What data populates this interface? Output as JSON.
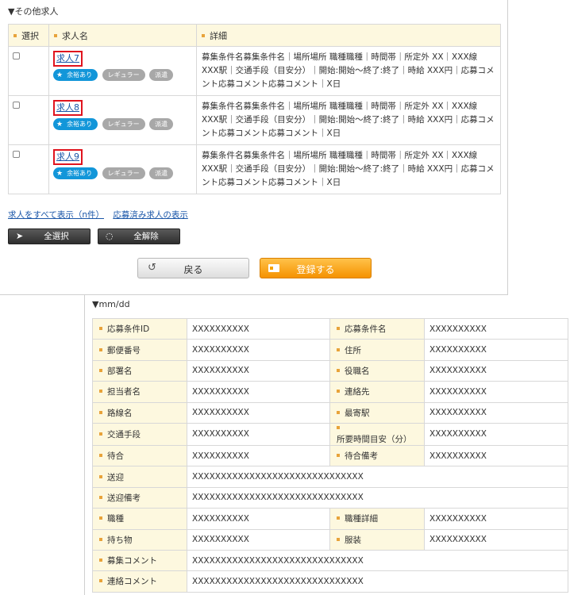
{
  "other_jobs": {
    "heading": "▼その他求人",
    "headers": {
      "select": "選択",
      "name": "求人名",
      "detail": "詳細"
    },
    "rows": [
      {
        "name": "求人7",
        "detail": "募集条件名募集条件名｜場所場所 職種職種｜時間帯｜所定外 XX｜XXX線 XXX駅｜交通手段（目安分）｜開始:開始〜終了:終了｜時給 XXX円｜応募コメント応募コメント応募コメント｜X日"
      },
      {
        "name": "求人8",
        "detail": "募集条件名募集条件名｜場所場所 職種職種｜時間帯｜所定外 XX｜XXX線 XXX駅｜交通手段（目安分）｜開始:開始〜終了:終了｜時給 XXX円｜応募コメント応募コメント応募コメント｜X日"
      },
      {
        "name": "求人9",
        "detail": "募集条件名募集条件名｜場所場所 職種職種｜時間帯｜所定外 XX｜XXX線 XXX駅｜交通手段（目安分）｜開始:開始〜終了:終了｜時給 XXX円｜応募コメント応募コメント応募コメント｜X日"
      }
    ],
    "tags": {
      "availability": "余裕あり",
      "regular": "レギュラー",
      "dispatch": "派遣"
    },
    "links": {
      "show_all": "求人をすべて表示（n件）",
      "show_applied": "応募済み求人の表示"
    },
    "buttons": {
      "select_all": "全選択",
      "clear_all": "全解除",
      "back": "戻る",
      "register": "登録する"
    }
  },
  "detail": {
    "heading": "▼mm/dd",
    "rows": [
      {
        "cells": [
          {
            "label": "応募条件ID",
            "value": "XXXXXXXXXX"
          },
          {
            "label": "応募条件名",
            "value": "XXXXXXXXXX"
          }
        ]
      },
      {
        "cells": [
          {
            "label": "郵便番号",
            "value": "XXXXXXXXXX"
          },
          {
            "label": "住所",
            "value": "XXXXXXXXXX"
          }
        ]
      },
      {
        "cells": [
          {
            "label": "部署名",
            "value": "XXXXXXXXXX"
          },
          {
            "label": "役職名",
            "value": "XXXXXXXXXX"
          }
        ]
      },
      {
        "cells": [
          {
            "label": "担当者名",
            "value": "XXXXXXXXXX"
          },
          {
            "label": "連絡先",
            "value": "XXXXXXXXXX"
          }
        ]
      },
      {
        "cells": [
          {
            "label": "路線名",
            "value": "XXXXXXXXXX"
          },
          {
            "label": "最寄駅",
            "value": "XXXXXXXXXX"
          }
        ]
      },
      {
        "cells": [
          {
            "label": "交通手段",
            "value": "XXXXXXXXXX"
          },
          {
            "label": "所要時間目安（分）",
            "value": "XXXXXXXXXX"
          }
        ]
      },
      {
        "cells": [
          {
            "label": "待合",
            "value": "XXXXXXXXXX"
          },
          {
            "label": "待合備考",
            "value": "XXXXXXXXXX"
          }
        ]
      },
      {
        "cells": [
          {
            "label": "送迎",
            "value": "XXXXXXXXXXXXXXXXXXXXXXXXXXXXXX"
          }
        ]
      },
      {
        "cells": [
          {
            "label": "送迎備考",
            "value": "XXXXXXXXXXXXXXXXXXXXXXXXXXXXXX"
          }
        ]
      },
      {
        "cells": [
          {
            "label": "職種",
            "value": "XXXXXXXXXX"
          },
          {
            "label": "職種詳細",
            "value": "XXXXXXXXXX"
          }
        ]
      },
      {
        "cells": [
          {
            "label": "持ち物",
            "value": "XXXXXXXXXX"
          },
          {
            "label": "服装",
            "value": "XXXXXXXXXX"
          }
        ]
      },
      {
        "cells": [
          {
            "label": "募集コメント",
            "value": "XXXXXXXXXXXXXXXXXXXXXXXXXXXXXX"
          }
        ]
      },
      {
        "cells": [
          {
            "label": "連絡コメント",
            "value": "XXXXXXXXXXXXXXXXXXXXXXXXXXXXXX"
          }
        ]
      }
    ]
  },
  "colors": {
    "header_bg": "#fdf8df",
    "accent_dot": "#e8a33a",
    "link": "#1a56a8",
    "highlight_border": "#e0141e",
    "tag_blue": "#1296d9",
    "tag_gray": "#a8a8a8",
    "register_orange": "#f59200"
  }
}
